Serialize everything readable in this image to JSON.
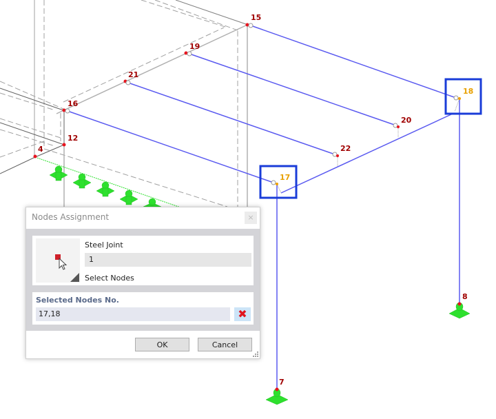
{
  "viewport": {
    "colors": {
      "node_dot": "#e8141e",
      "node_label": "#a00000",
      "selected_label": "#e8a000",
      "selected_dot": "#f0a000",
      "member_selected": "#5a5af0",
      "member_other": "#b0b0b0",
      "support": "#2ee02e",
      "selection_box": "#1a3cd8"
    },
    "nodes": [
      {
        "id": "15",
        "label": "15",
        "selected": false
      },
      {
        "id": "19",
        "label": "19",
        "selected": false
      },
      {
        "id": "21",
        "label": "21",
        "selected": false
      },
      {
        "id": "16",
        "label": "16",
        "selected": false
      },
      {
        "id": "12",
        "label": "12",
        "selected": false
      },
      {
        "id": "4",
        "label": "4",
        "selected": false
      },
      {
        "id": "18",
        "label": "18",
        "selected": true
      },
      {
        "id": "20",
        "label": "20",
        "selected": false
      },
      {
        "id": "22",
        "label": "22",
        "selected": false
      },
      {
        "id": "17",
        "label": "17",
        "selected": true
      },
      {
        "id": "8",
        "label": "8",
        "selected": false
      },
      {
        "id": "7",
        "label": "7",
        "selected": false
      }
    ]
  },
  "dialog": {
    "title": "Nodes Assignment",
    "close_icon": "close-icon",
    "object_type": "Steel Joint",
    "object_number": "1",
    "select_label": "Select Nodes",
    "pick_icon": "select-nodes-cursor-icon",
    "selected_title": "Selected Nodes No.",
    "selected_value": "17,18",
    "clear_icon": "clear-x-icon",
    "clear_glyph": "✖",
    "close_glyph": "×",
    "ok_label": "OK",
    "cancel_label": "Cancel"
  }
}
